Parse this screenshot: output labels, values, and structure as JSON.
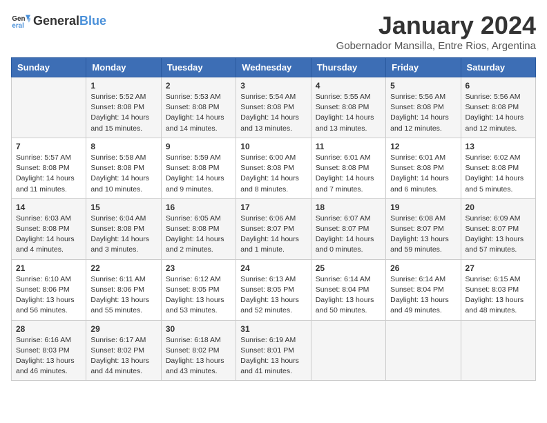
{
  "header": {
    "logo_general": "General",
    "logo_blue": "Blue",
    "month_year": "January 2024",
    "location": "Gobernador Mansilla, Entre Rios, Argentina"
  },
  "days_of_week": [
    "Sunday",
    "Monday",
    "Tuesday",
    "Wednesday",
    "Thursday",
    "Friday",
    "Saturday"
  ],
  "weeks": [
    [
      {
        "day": "",
        "info": ""
      },
      {
        "day": "1",
        "info": "Sunrise: 5:52 AM\nSunset: 8:08 PM\nDaylight: 14 hours\nand 15 minutes."
      },
      {
        "day": "2",
        "info": "Sunrise: 5:53 AM\nSunset: 8:08 PM\nDaylight: 14 hours\nand 14 minutes."
      },
      {
        "day": "3",
        "info": "Sunrise: 5:54 AM\nSunset: 8:08 PM\nDaylight: 14 hours\nand 13 minutes."
      },
      {
        "day": "4",
        "info": "Sunrise: 5:55 AM\nSunset: 8:08 PM\nDaylight: 14 hours\nand 13 minutes."
      },
      {
        "day": "5",
        "info": "Sunrise: 5:56 AM\nSunset: 8:08 PM\nDaylight: 14 hours\nand 12 minutes."
      },
      {
        "day": "6",
        "info": "Sunrise: 5:56 AM\nSunset: 8:08 PM\nDaylight: 14 hours\nand 12 minutes."
      }
    ],
    [
      {
        "day": "7",
        "info": "Sunrise: 5:57 AM\nSunset: 8:08 PM\nDaylight: 14 hours\nand 11 minutes."
      },
      {
        "day": "8",
        "info": "Sunrise: 5:58 AM\nSunset: 8:08 PM\nDaylight: 14 hours\nand 10 minutes."
      },
      {
        "day": "9",
        "info": "Sunrise: 5:59 AM\nSunset: 8:08 PM\nDaylight: 14 hours\nand 9 minutes."
      },
      {
        "day": "10",
        "info": "Sunrise: 6:00 AM\nSunset: 8:08 PM\nDaylight: 14 hours\nand 8 minutes."
      },
      {
        "day": "11",
        "info": "Sunrise: 6:01 AM\nSunset: 8:08 PM\nDaylight: 14 hours\nand 7 minutes."
      },
      {
        "day": "12",
        "info": "Sunrise: 6:01 AM\nSunset: 8:08 PM\nDaylight: 14 hours\nand 6 minutes."
      },
      {
        "day": "13",
        "info": "Sunrise: 6:02 AM\nSunset: 8:08 PM\nDaylight: 14 hours\nand 5 minutes."
      }
    ],
    [
      {
        "day": "14",
        "info": "Sunrise: 6:03 AM\nSunset: 8:08 PM\nDaylight: 14 hours\nand 4 minutes."
      },
      {
        "day": "15",
        "info": "Sunrise: 6:04 AM\nSunset: 8:08 PM\nDaylight: 14 hours\nand 3 minutes."
      },
      {
        "day": "16",
        "info": "Sunrise: 6:05 AM\nSunset: 8:08 PM\nDaylight: 14 hours\nand 2 minutes."
      },
      {
        "day": "17",
        "info": "Sunrise: 6:06 AM\nSunset: 8:07 PM\nDaylight: 14 hours\nand 1 minute."
      },
      {
        "day": "18",
        "info": "Sunrise: 6:07 AM\nSunset: 8:07 PM\nDaylight: 14 hours\nand 0 minutes."
      },
      {
        "day": "19",
        "info": "Sunrise: 6:08 AM\nSunset: 8:07 PM\nDaylight: 13 hours\nand 59 minutes."
      },
      {
        "day": "20",
        "info": "Sunrise: 6:09 AM\nSunset: 8:07 PM\nDaylight: 13 hours\nand 57 minutes."
      }
    ],
    [
      {
        "day": "21",
        "info": "Sunrise: 6:10 AM\nSunset: 8:06 PM\nDaylight: 13 hours\nand 56 minutes."
      },
      {
        "day": "22",
        "info": "Sunrise: 6:11 AM\nSunset: 8:06 PM\nDaylight: 13 hours\nand 55 minutes."
      },
      {
        "day": "23",
        "info": "Sunrise: 6:12 AM\nSunset: 8:05 PM\nDaylight: 13 hours\nand 53 minutes."
      },
      {
        "day": "24",
        "info": "Sunrise: 6:13 AM\nSunset: 8:05 PM\nDaylight: 13 hours\nand 52 minutes."
      },
      {
        "day": "25",
        "info": "Sunrise: 6:14 AM\nSunset: 8:04 PM\nDaylight: 13 hours\nand 50 minutes."
      },
      {
        "day": "26",
        "info": "Sunrise: 6:14 AM\nSunset: 8:04 PM\nDaylight: 13 hours\nand 49 minutes."
      },
      {
        "day": "27",
        "info": "Sunrise: 6:15 AM\nSunset: 8:03 PM\nDaylight: 13 hours\nand 48 minutes."
      }
    ],
    [
      {
        "day": "28",
        "info": "Sunrise: 6:16 AM\nSunset: 8:03 PM\nDaylight: 13 hours\nand 46 minutes."
      },
      {
        "day": "29",
        "info": "Sunrise: 6:17 AM\nSunset: 8:02 PM\nDaylight: 13 hours\nand 44 minutes."
      },
      {
        "day": "30",
        "info": "Sunrise: 6:18 AM\nSunset: 8:02 PM\nDaylight: 13 hours\nand 43 minutes."
      },
      {
        "day": "31",
        "info": "Sunrise: 6:19 AM\nSunset: 8:01 PM\nDaylight: 13 hours\nand 41 minutes."
      },
      {
        "day": "",
        "info": ""
      },
      {
        "day": "",
        "info": ""
      },
      {
        "day": "",
        "info": ""
      }
    ]
  ]
}
